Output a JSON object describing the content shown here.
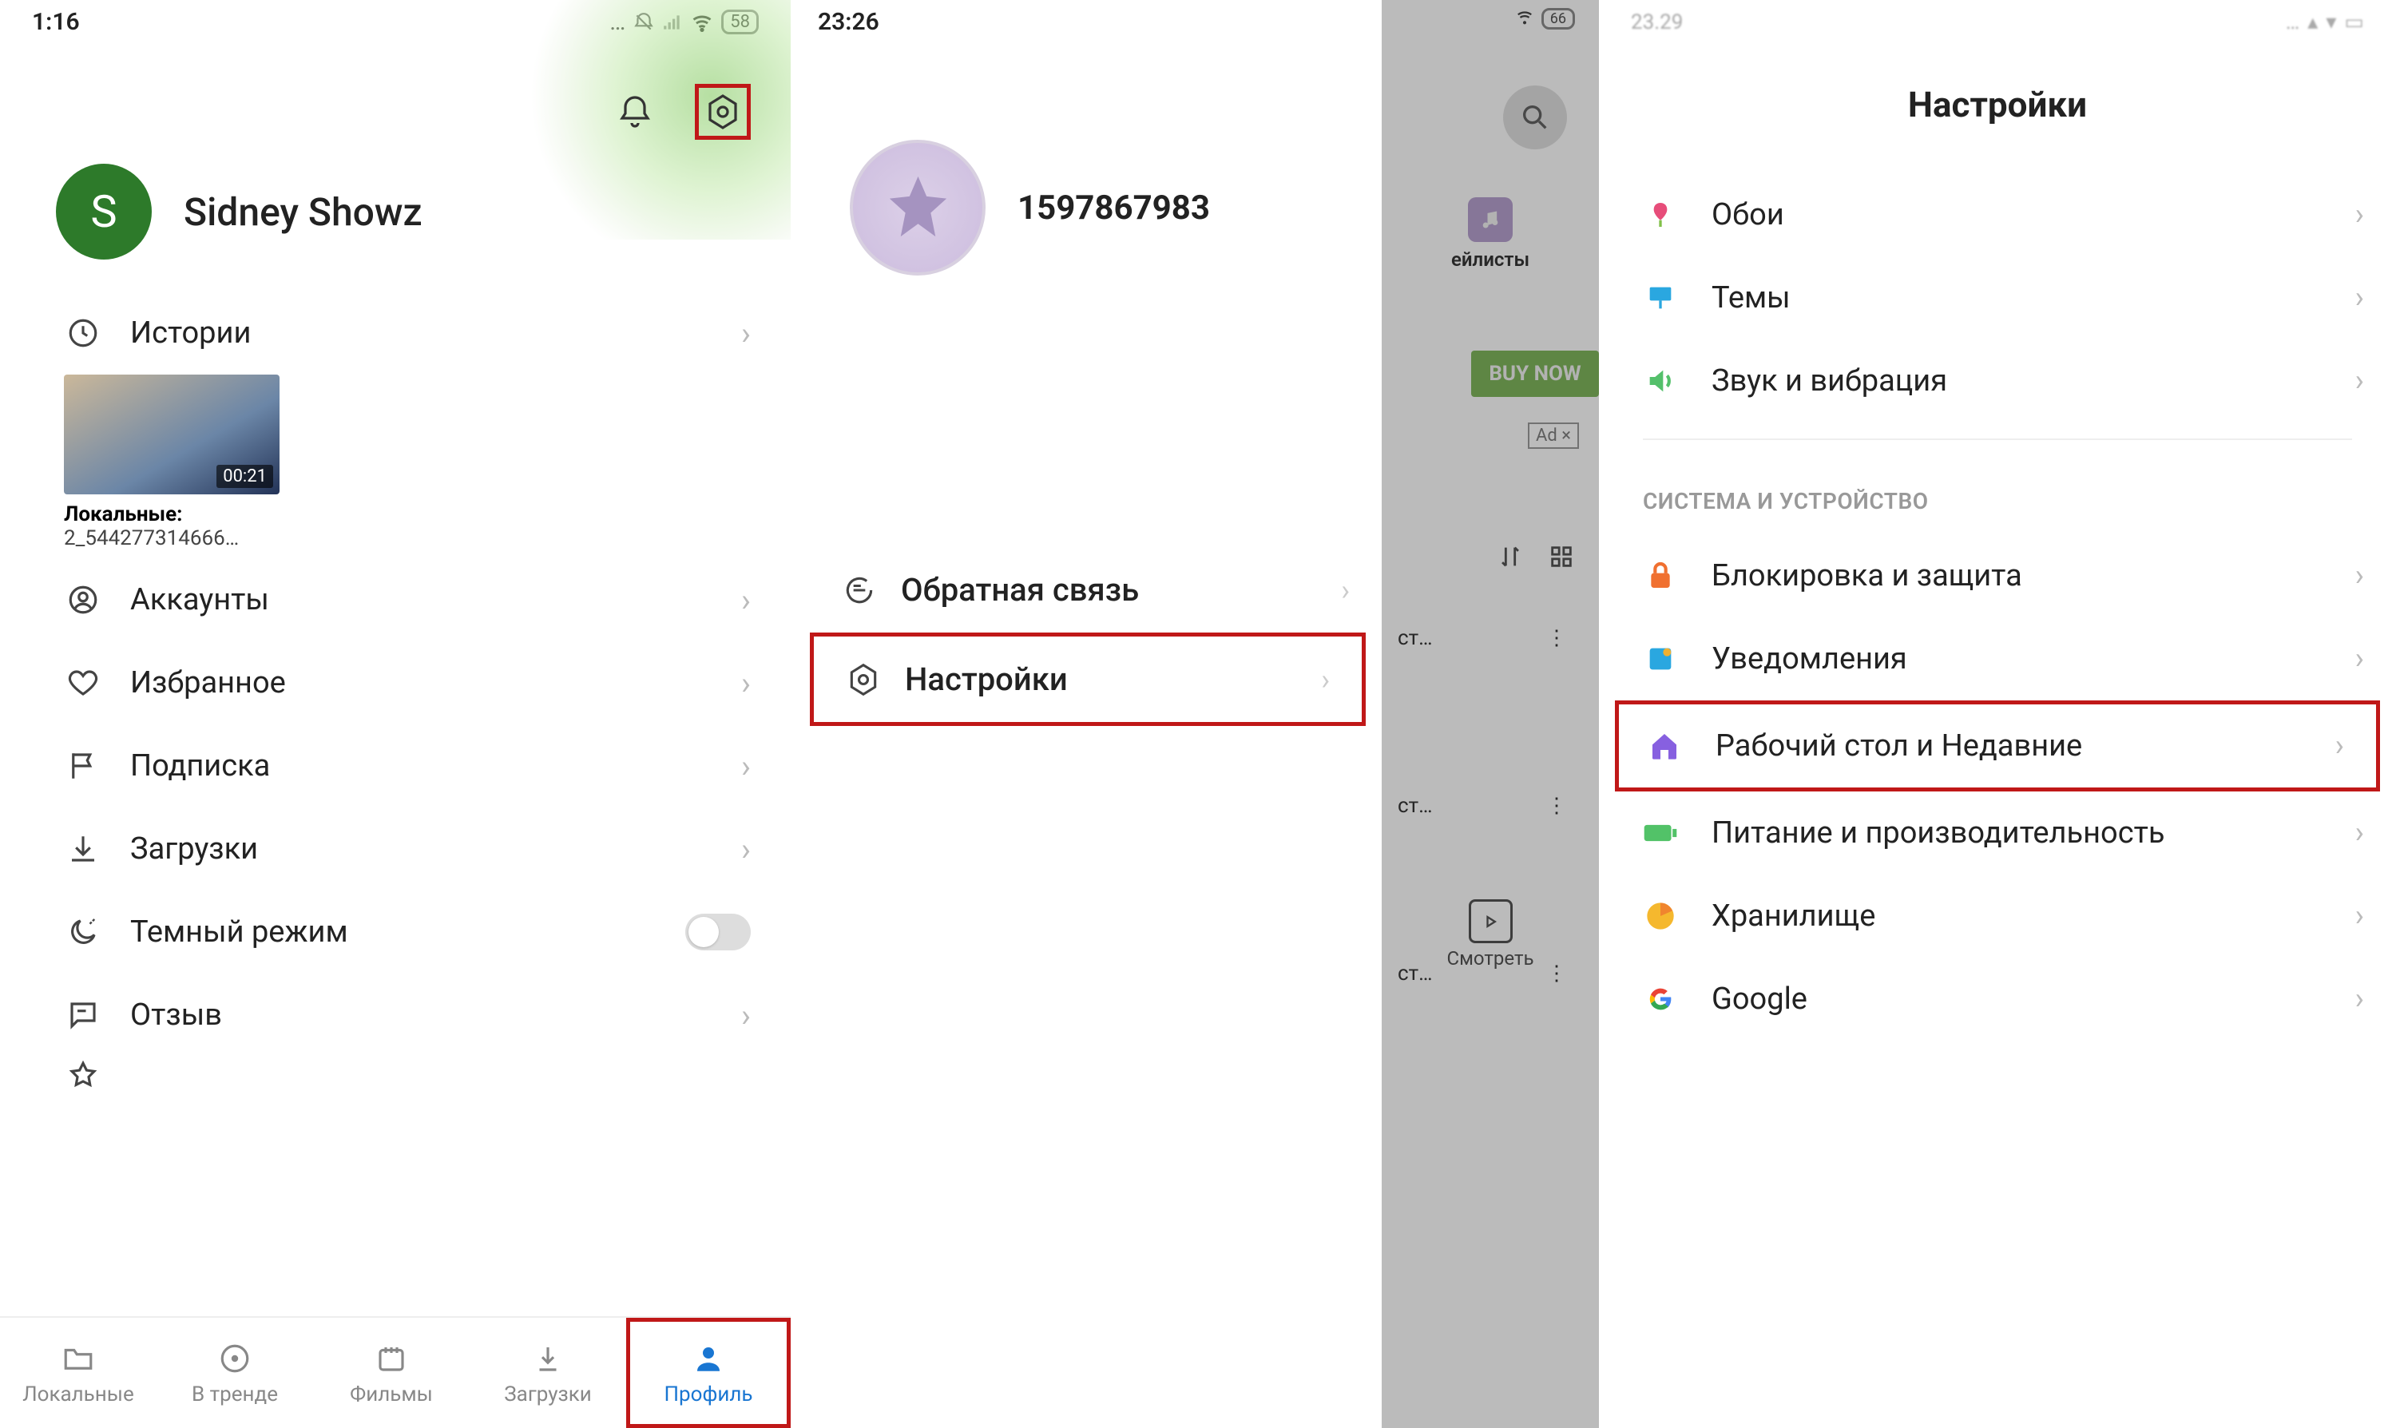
{
  "pane1": {
    "status_time": "1:16",
    "battery": "58",
    "profile_initial": "S",
    "profile_name": "Sidney Showz",
    "menu": {
      "history": "Истории",
      "thumb_duration": "00:21",
      "thumb_title": "Локальные:",
      "thumb_sub": "2_544277314666…",
      "accounts": "Аккаунты",
      "favorites": "Избранное",
      "subscription": "Подписка",
      "downloads": "Загрузки",
      "darkmode": "Темный режим",
      "feedback": "Отзыв"
    },
    "tabs": {
      "local": "Локальные",
      "trending": "В тренде",
      "movies": "Фильмы",
      "downloads": "Загрузки",
      "profile": "Профиль"
    }
  },
  "pane2": {
    "status_time": "23:26",
    "user_id": "1597867983",
    "feedback": "Обратная связь",
    "settings": "Настройки"
  },
  "pane2b": {
    "battery": "66",
    "playlists": "ейлисты",
    "buy": "BUY NOW",
    "ad": "Ad ×",
    "item_suffix": "ст…",
    "watch": "Смотреть"
  },
  "pane3": {
    "status_time": "23.29",
    "title": "Настройки",
    "wallpaper": "Обои",
    "themes": "Темы",
    "sound": "Звук и вибрация",
    "section_system": "СИСТЕМА И УСТРОЙСТВО",
    "lock": "Блокировка и защита",
    "notifications": "Уведомления",
    "home": "Рабочий стол и Недавние",
    "power": "Питание и производительность",
    "storage": "Хранилище",
    "google": "Google"
  }
}
